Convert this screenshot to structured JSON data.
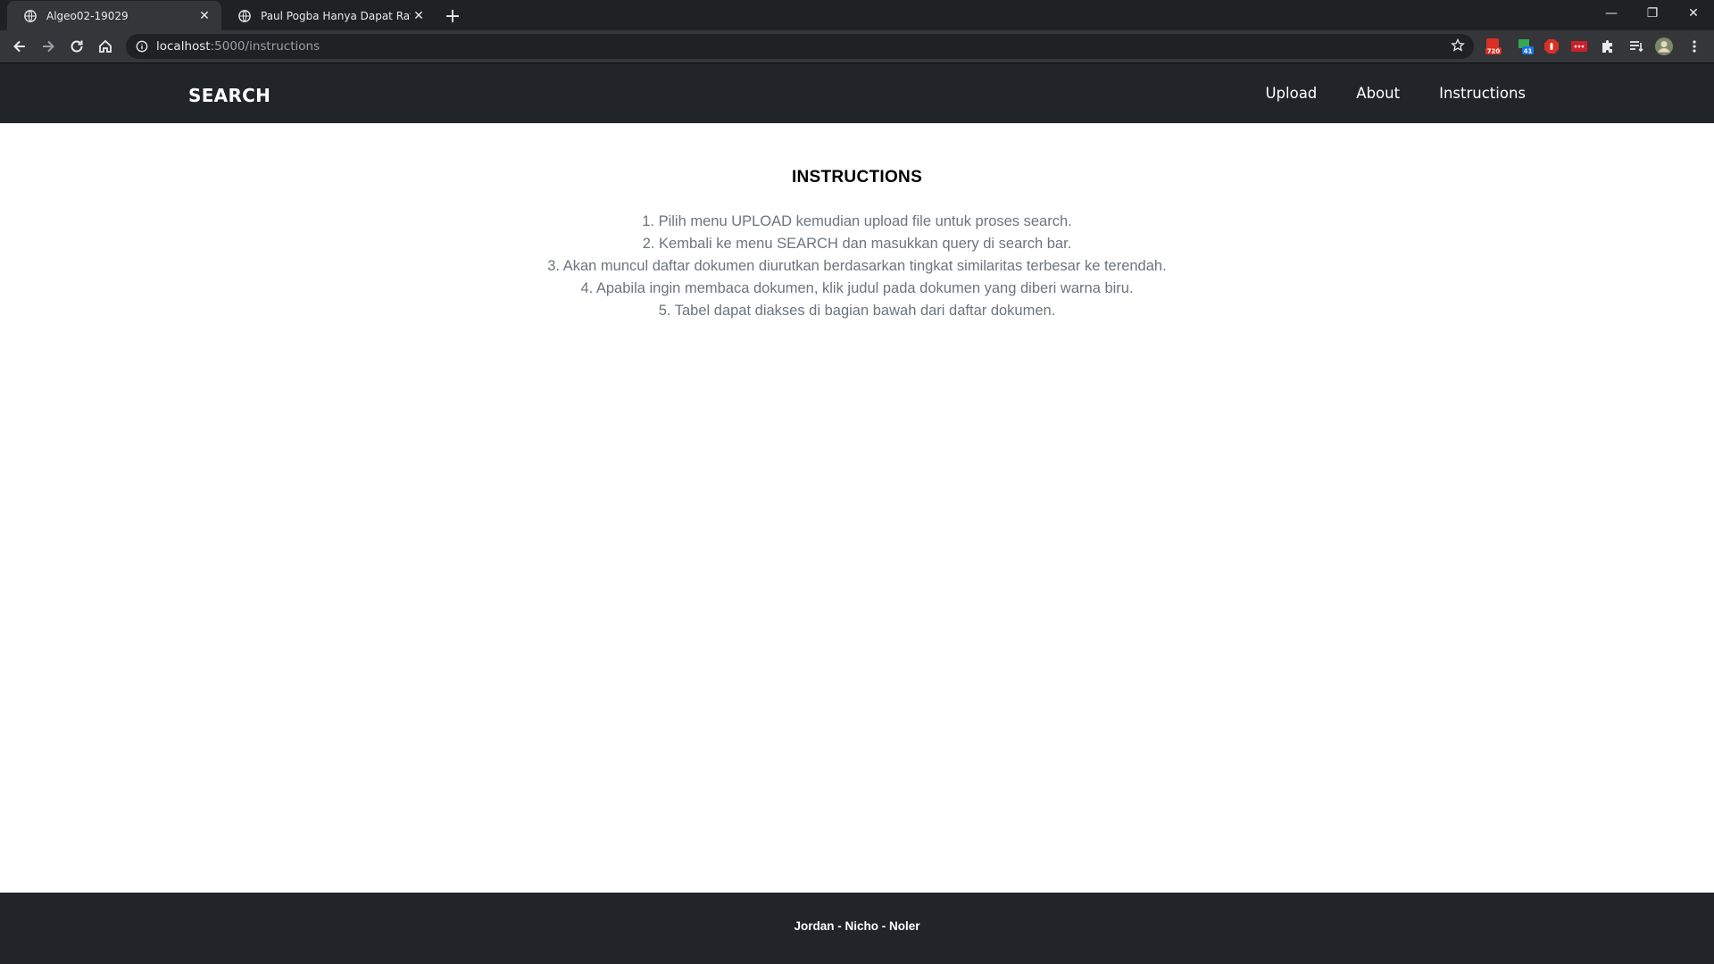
{
  "browser": {
    "tabs": [
      {
        "title": "Algeo02-19029",
        "active": true
      },
      {
        "title": "Paul Pogba Hanya Dapat Rating",
        "active": false
      }
    ],
    "url_host": "localhost",
    "url_rest": ":5000/instructions",
    "extensions": [
      {
        "icon": "video-speed-extension-icon",
        "badge": "720",
        "color": "#d93025"
      },
      {
        "icon": "calendar-extension-icon",
        "badge": "41",
        "color": "#1a73e8"
      },
      {
        "icon": "adblock-extension-icon",
        "badge": "",
        "color": "#d93025"
      },
      {
        "icon": "lastpass-extension-icon",
        "badge": "",
        "color": "#cc2029"
      }
    ]
  },
  "site": {
    "brand": "SEARCH",
    "nav": [
      "Upload",
      "About",
      "Instructions"
    ]
  },
  "main": {
    "heading": "INSTRUCTIONS",
    "steps": [
      "1. Pilih menu UPLOAD kemudian upload file untuk proses search.",
      "2. Kembali ke menu SEARCH dan masukkan query di search bar.",
      "3. Akan muncul daftar dokumen diurutkan berdasarkan tingkat similaritas terbesar ke terendah.",
      "4. Apabila ingin membaca dokumen, klik judul pada dokumen yang diberi warna biru.",
      "5. Tabel dapat diakses di bagian bawah dari daftar dokumen."
    ]
  },
  "footer": {
    "credits": "Jordan - Nicho - Noler"
  },
  "colors": {
    "header_bg": "#212529",
    "text_muted": "#6c757d"
  }
}
